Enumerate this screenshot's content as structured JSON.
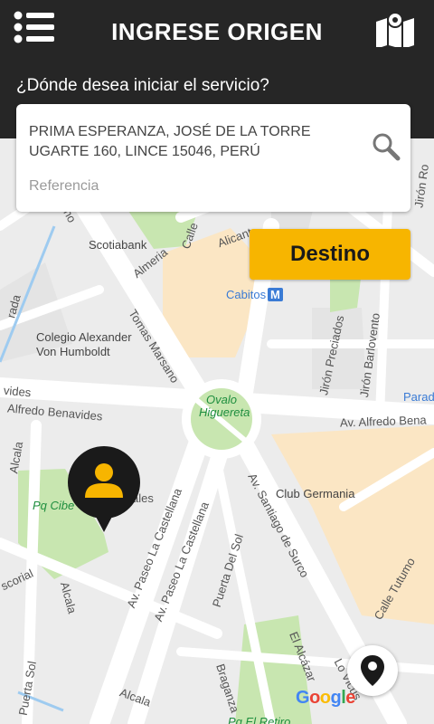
{
  "header": {
    "title": "INGRESE ORIGEN",
    "menu_icon": "menu-icon",
    "map_icon": "folded-map-icon"
  },
  "origin": {
    "question": "¿Dónde desea iniciar el servicio?",
    "address": "PRIMA ESPERANZA, JOSÉ DE LA TORRE UGARTE 160, LINCE 15046, PERÚ",
    "reference_placeholder": "Referencia",
    "search_icon": "search-icon"
  },
  "destino_button": "Destino",
  "map": {
    "labels": {
      "scotiabank": "Scotiabank",
      "almeria": "Almeria",
      "alicante": "Alicant",
      "cabitos": "Cabitos",
      "cabitos_badge": "M",
      "tomas_marsano": "Tomas Marsano",
      "colegio_1": "Colegio Alexander",
      "colegio_2": "Von Humboldt",
      "ovalo_1": "Ovalo",
      "ovalo_2": "Higuereta",
      "benavides_left": "Alfredo Benavides",
      "benavides_right": "Av. Alfredo Bena",
      "vides": "vides",
      "parade": "Parade",
      "jiron_preciados": "Jirón Preciados",
      "jiron_barlovento": "Jirón Barlovento",
      "jiron_ron": "Jirón Ro",
      "club_germania": "Club Germania",
      "pq_cibeles": "Pq Cibe",
      "castellana_1": "Av. Paseo La Castellana",
      "castellana_2": "Av. Paseo La Castellana",
      "santiago_surco": "Av. Santiago de Surco",
      "puerta_sol": "Puerta Del Sol",
      "tutumo": "Calle Tutumo",
      "alcala_1": "Alcala",
      "alcala_2": "Alcala",
      "alcala_3": "Alcala",
      "escorial": "scorial",
      "braganza": "Braganza",
      "el_alcazar": "El Alcázar",
      "pq_el_retiro": "Pq El Retiro",
      "puerta_sol_bottom": "Puerta Sol",
      "lo_vicus": "Lo Vicus",
      "sano": "sano",
      "calle": "Calle",
      "rada": "rada",
      "ales": "ales"
    }
  },
  "pin_icon": "person-marker-icon",
  "my_location_icon": "location-pin-icon",
  "google_logo": "Google",
  "colors": {
    "header_bg": "#262626",
    "accent": "#f7b500",
    "map_bg": "#ececec",
    "park": "#c8e6b0",
    "building": "#fbe6c4"
  }
}
